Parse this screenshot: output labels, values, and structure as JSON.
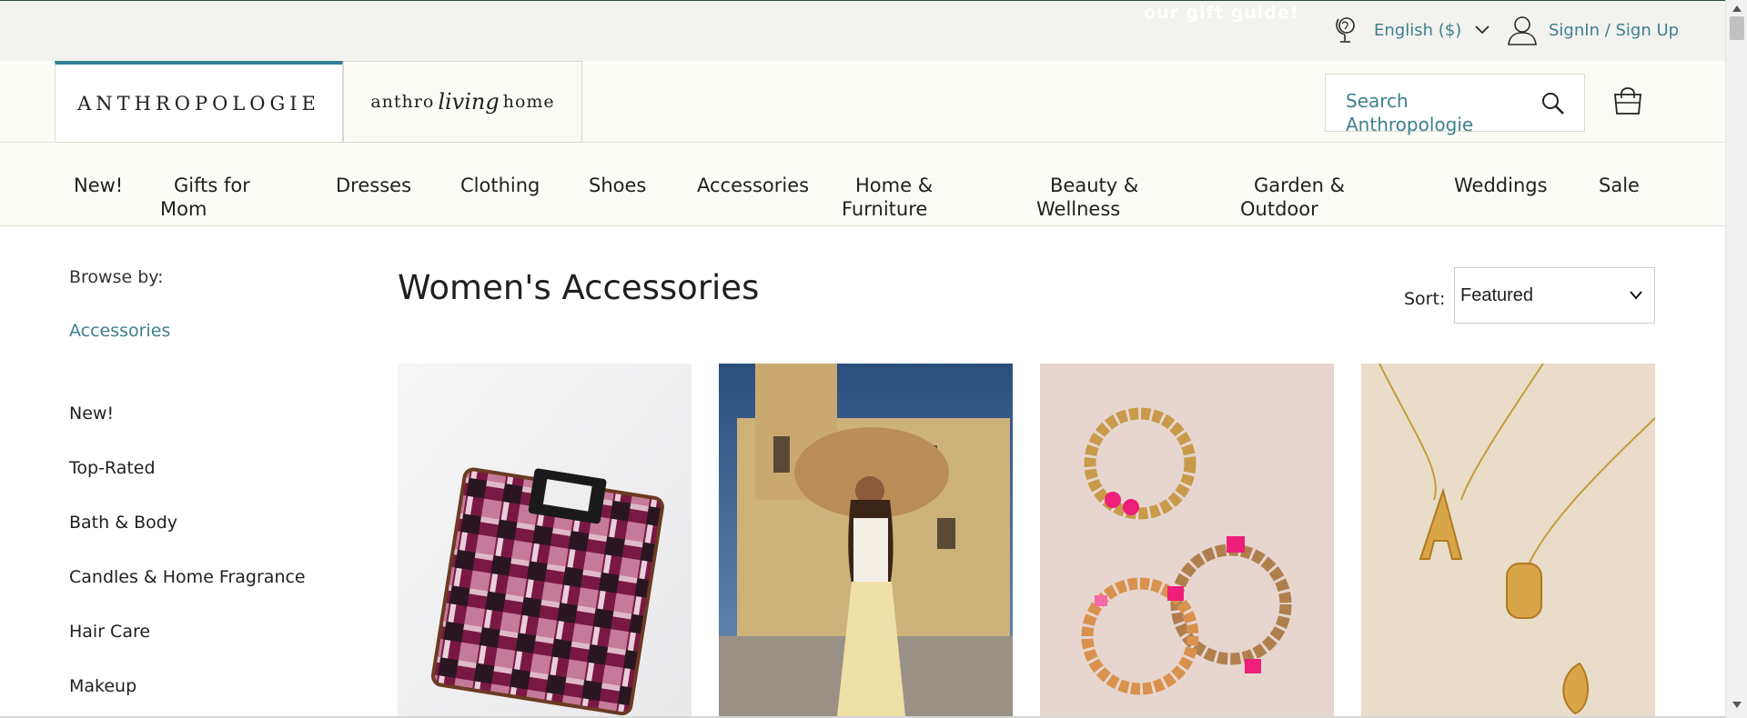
{
  "topbar": {
    "promo": "our gift guide!",
    "language": "English ($)",
    "signin": "SignIn / Sign Up"
  },
  "brand": {
    "anthropologie": "ANTHROPOLOGIE",
    "living_pre": "anthro",
    "living_script": "living",
    "living_post": "home"
  },
  "search": {
    "placeholder": "Search Anthropologie"
  },
  "nav": {
    "items": [
      {
        "line1": "New!",
        "line2": ""
      },
      {
        "line1": "Gifts for",
        "line2": "Mom"
      },
      {
        "line1": "Dresses",
        "line2": ""
      },
      {
        "line1": "Clothing",
        "line2": ""
      },
      {
        "line1": "Shoes",
        "line2": ""
      },
      {
        "line1": "Accessories",
        "line2": ""
      },
      {
        "line1": "Home &",
        "line2": "Furniture"
      },
      {
        "line1": "Beauty &",
        "line2": "Wellness"
      },
      {
        "line1": "Garden &",
        "line2": "Outdoor"
      },
      {
        "line1": "Weddings",
        "line2": ""
      },
      {
        "line1": "Sale",
        "line2": ""
      }
    ]
  },
  "sidebar": {
    "browse_label": "Browse by:",
    "category": "Accessories",
    "items": [
      "New!",
      "Top-Rated",
      "Bath & Body",
      "Candles & Home Fragrance",
      "Hair Care",
      "Makeup"
    ]
  },
  "main": {
    "title": "Women's Accessories",
    "sort_label": "Sort:",
    "sort_value": "Featured"
  },
  "colors": {
    "accent_teal": "#3f7f8f",
    "tab_top": "#2f7f96",
    "nav_bg": "#fcfcf6",
    "topbar_bg": "#f2f2ee"
  },
  "icons": [
    "globe-icon",
    "chevron-down-icon",
    "user-icon",
    "search-icon",
    "shopping-bag-icon"
  ]
}
